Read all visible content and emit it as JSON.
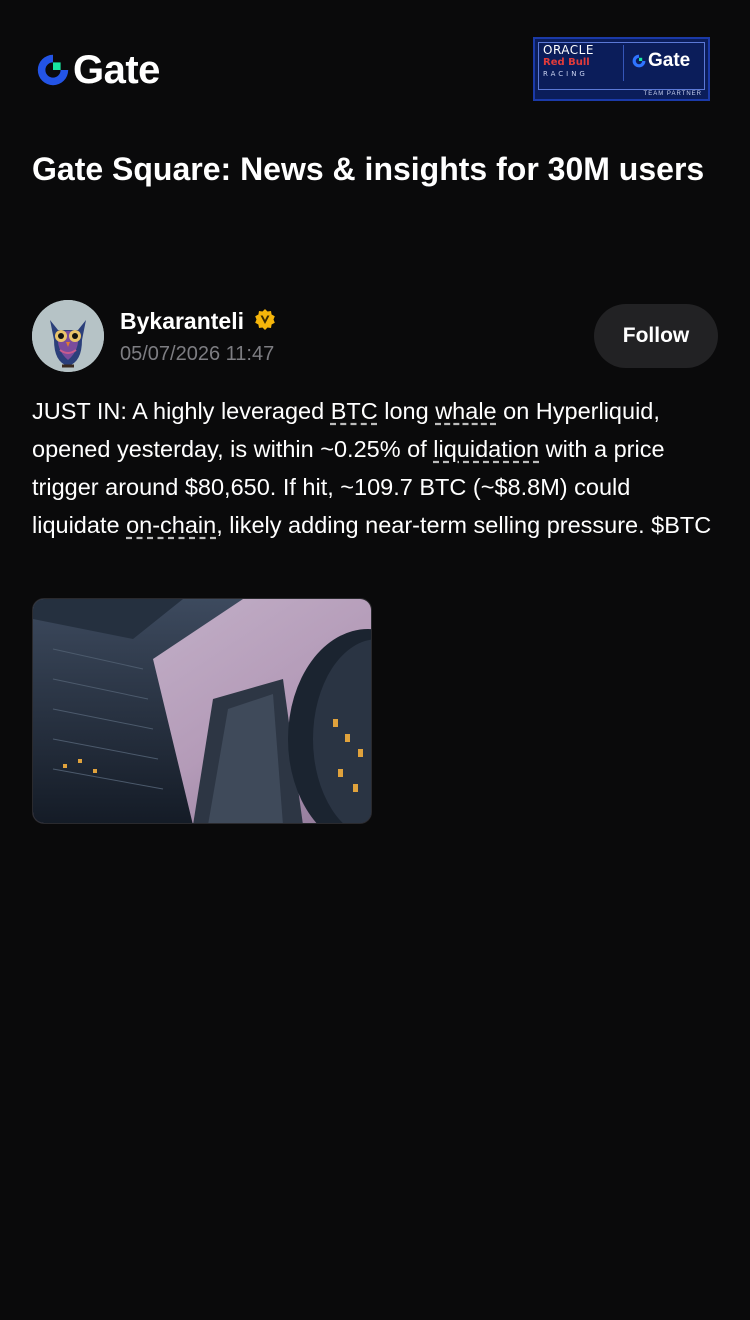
{
  "header": {
    "logo_text": "Gate",
    "partner_badge": {
      "oracle": "ORACLE",
      "redbull": "Red Bull",
      "racing": "RACING",
      "gate": "Gate",
      "team_partner": "TEAM PARTNER"
    }
  },
  "page_title": "Gate Square: News & insights for 30M users",
  "post": {
    "author": "Bykaranteli",
    "timestamp": "05/07/2026 11:47",
    "follow_label": "Follow",
    "body": {
      "t1": "JUST IN: A highly leveraged ",
      "tag_btc": "BTC",
      "t2": " long ",
      "tag_whale": "whale",
      "t3": " on Hyperliquid, opened yesterday, is within ~0.25% of ",
      "tag_liquidation": "liquidation",
      "t4": " with a price trigger around $80,650. If hit, ~109.7 BTC (~$8.8M) could liquidate ",
      "tag_onchain": "on-chain",
      "t5": ", likely adding near-term selling pressure. $BTC"
    }
  },
  "colors": {
    "background": "#0a0a0b",
    "brand_blue": "#2354e6",
    "brand_green": "#17e6a1",
    "muted_text": "#7d7d82",
    "follow_bg": "#222224",
    "verified_gold": "#f5b50a"
  },
  "icons": [
    "gate-logo-icon",
    "verified-badge-icon",
    "avatar-owl-image",
    "skyscrapers-image"
  ]
}
